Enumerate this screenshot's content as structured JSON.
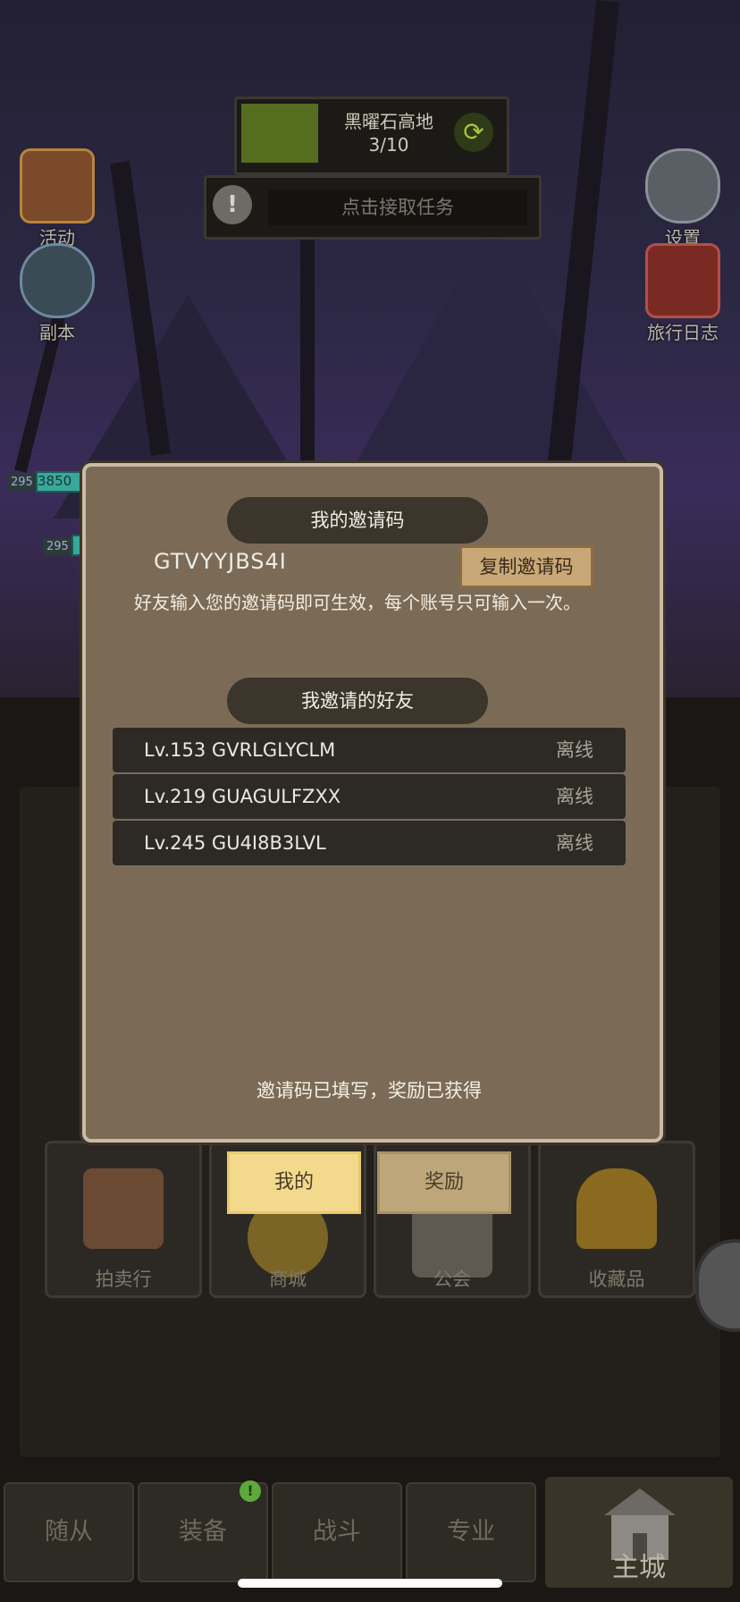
{
  "hud": {
    "area_name": "黑曜石高地",
    "area_progress": "3/10",
    "task_text": "点击接取任务",
    "task_icon": "!",
    "refresh_icon": "refresh-icon"
  },
  "side_left": [
    {
      "label": "活动",
      "icon": "event-book-icon"
    },
    {
      "label": "副本",
      "icon": "dungeon-portal-icon"
    }
  ],
  "side_right": [
    {
      "label": "设置",
      "icon": "gear-icon"
    },
    {
      "label": "旅行日志",
      "icon": "journal-icon"
    }
  ],
  "units": [
    {
      "level": "295",
      "hp": "3850"
    },
    {
      "level": "295",
      "hp": ""
    }
  ],
  "modal": {
    "my_code_title": "我的邀请码",
    "code": "GTVYYJBS4I",
    "copy_label": "复制邀请码",
    "note": "好友输入您的邀请码即可生效，每个账号只可输入一次。",
    "friends_title": "我邀请的好友",
    "friends": [
      {
        "name": "Lv.153 GVRLGLYCLM",
        "status": "离线"
      },
      {
        "name": "Lv.219 GUAGULFZXX",
        "status": "离线"
      },
      {
        "name": "Lv.245 GU4I8B3LVL",
        "status": "离线"
      }
    ],
    "footer": "邀请码已填写，奖励已获得"
  },
  "tabs": {
    "mine": "我的",
    "reward": "奖励"
  },
  "tiles": [
    {
      "label": "拍卖行",
      "icon": "auction-hammer-icon"
    },
    {
      "label": "商城",
      "icon": "shop-coin-icon"
    },
    {
      "label": "公会",
      "icon": "guild-hall-icon"
    },
    {
      "label": "收藏品",
      "icon": "helmet-icon"
    }
  ],
  "nav": {
    "items": [
      "随从",
      "装备",
      "战斗",
      "专业"
    ],
    "main": "主城",
    "badge": "!"
  },
  "colors": {
    "modal_bg": "#7b6b56",
    "pill_bg": "#3b352b",
    "tab_active": "#f2d98c"
  }
}
